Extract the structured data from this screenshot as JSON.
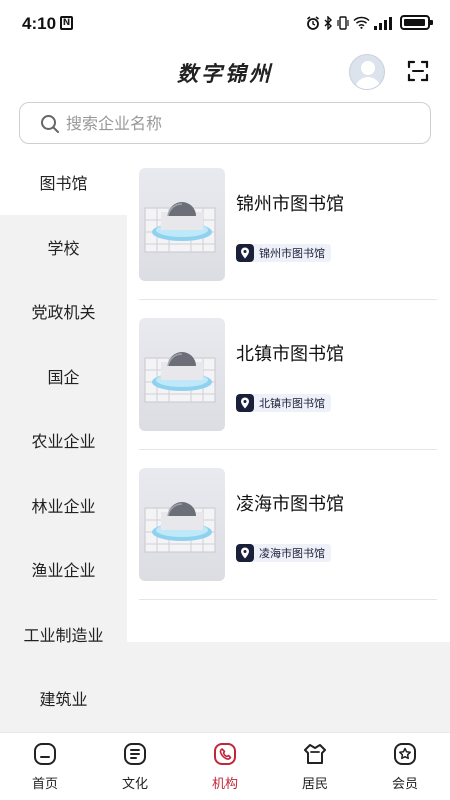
{
  "status_bar": {
    "time": "4:10",
    "n_badge": "N",
    "icons": [
      "alarm-icon",
      "bluetooth-icon",
      "vibrate-icon",
      "wifi-icon",
      "signal-icon",
      "battery-icon"
    ]
  },
  "header": {
    "title": "数字锦州"
  },
  "search": {
    "placeholder": "搜索企业名称"
  },
  "sidebar": {
    "items": [
      {
        "label": "图书馆",
        "active": true
      },
      {
        "label": "学校",
        "active": false
      },
      {
        "label": "党政机关",
        "active": false
      },
      {
        "label": "国企",
        "active": false
      },
      {
        "label": "农业企业",
        "active": false
      },
      {
        "label": "林业企业",
        "active": false
      },
      {
        "label": "渔业企业",
        "active": false
      },
      {
        "label": "工业制造业",
        "active": false
      },
      {
        "label": "建筑业",
        "active": false
      }
    ]
  },
  "list": {
    "items": [
      {
        "name": "锦州市图书馆",
        "tag": "锦州市图书馆"
      },
      {
        "name": "北镇市图书馆",
        "tag": "北镇市图书馆"
      },
      {
        "name": "凌海市图书馆",
        "tag": "凌海市图书馆"
      }
    ]
  },
  "bottom_nav": {
    "items": [
      {
        "label": "首页",
        "icon": "home-icon"
      },
      {
        "label": "文化",
        "icon": "culture-icon"
      },
      {
        "label": "机构",
        "icon": "institution-icon",
        "active": true
      },
      {
        "label": "居民",
        "icon": "residents-icon"
      },
      {
        "label": "会员",
        "icon": "member-icon"
      }
    ]
  },
  "colors": {
    "accent": "#c0283a",
    "tag_bg": "#eef1f8",
    "tag_icon": "#1a1f3a"
  }
}
